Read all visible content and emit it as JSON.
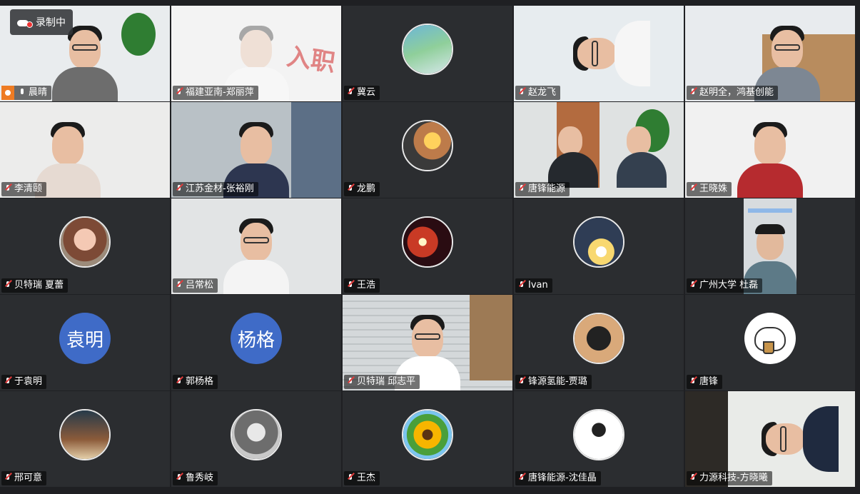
{
  "recording": {
    "label": "录制中"
  },
  "tiles": [
    {
      "name": "晨晴",
      "kind": "video",
      "host": true,
      "mic_on": true
    },
    {
      "name": "福建亚南-郑丽萍",
      "kind": "video"
    },
    {
      "name": "冀云",
      "kind": "avatar",
      "photo": "ph-a"
    },
    {
      "name": "赵龙飞",
      "kind": "video"
    },
    {
      "name": "赵明全，鸿基创能",
      "kind": "video"
    },
    {
      "name": "李清颐",
      "kind": "video"
    },
    {
      "name": "江苏金材-张裕刚",
      "kind": "video"
    },
    {
      "name": "龙鹏",
      "kind": "avatar",
      "photo": "ph-c"
    },
    {
      "name": "唐锋能源",
      "kind": "video"
    },
    {
      "name": "王晓姝",
      "kind": "video"
    },
    {
      "name": "贝特瑞 夏蕾",
      "kind": "avatar",
      "photo": "ph-c"
    },
    {
      "name": "吕常松",
      "kind": "video"
    },
    {
      "name": "王浩",
      "kind": "avatar",
      "photo": "ph-d"
    },
    {
      "name": "Ivan",
      "kind": "avatar",
      "photo": "ph-e"
    },
    {
      "name": "广州大学 杜磊",
      "kind": "video"
    },
    {
      "name": "于袁明",
      "kind": "text",
      "avatar_text": "袁明"
    },
    {
      "name": "郭杨格",
      "kind": "text",
      "avatar_text": "杨格"
    },
    {
      "name": "贝特瑞 邱志平",
      "kind": "video"
    },
    {
      "name": "锋源氢能-贾璐",
      "kind": "avatar",
      "photo": "ph-f"
    },
    {
      "name": "唐锋",
      "kind": "bear"
    },
    {
      "name": "邢可意",
      "kind": "avatar",
      "photo": "ph-h"
    },
    {
      "name": "鲁秀岐",
      "kind": "avatar",
      "photo": "ph-i"
    },
    {
      "name": "王杰",
      "kind": "avatar",
      "photo": "ph-j"
    },
    {
      "name": "唐锋能源-沈佳晶",
      "kind": "avatar",
      "photo": "ph-k"
    },
    {
      "name": "力源科技-方晓曦",
      "kind": "video"
    }
  ]
}
